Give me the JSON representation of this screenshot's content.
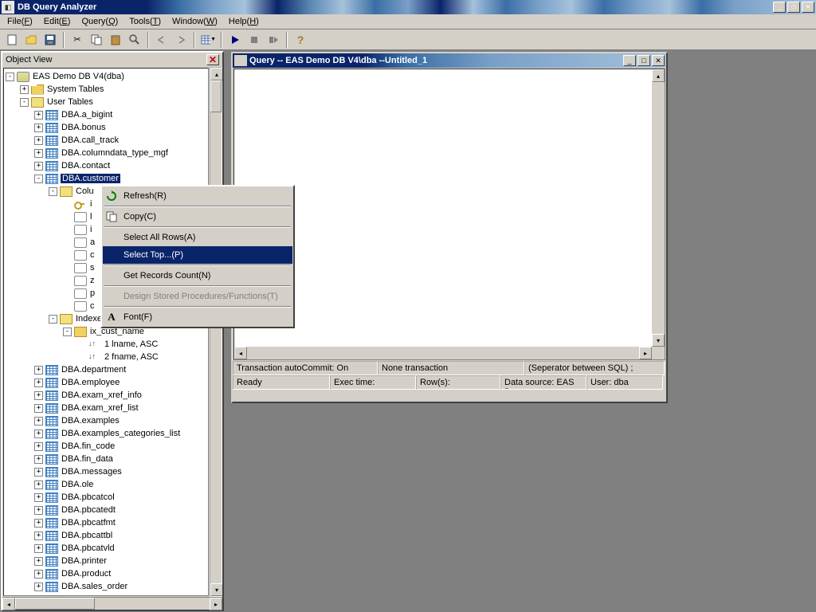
{
  "titlebar": {
    "title": "DB Query Analyzer"
  },
  "menubar": {
    "file": "File(F)",
    "edit": "Edit(E)",
    "query": "Query(Q)",
    "tools": "Tools(T)",
    "window": "Window(W)",
    "help": "Help(H)"
  },
  "objectview": {
    "title": "Object View",
    "root": "EAS Demo DB V4(dba)",
    "system_tables": "System Tables",
    "user_tables": "User Tables",
    "tables": [
      "DBA.a_bigint",
      "DBA.bonus",
      "DBA.call_track",
      "DBA.columndata_type_mgf",
      "DBA.contact"
    ],
    "selected_table": "DBA.customer",
    "columns_label": "Columns",
    "indexes_label": "Indexes",
    "index_name": "ix_cust_name",
    "index_cols": [
      "1  lname, ASC",
      "2  fname, ASC"
    ],
    "col_placeholders": [
      "i",
      "l",
      "i",
      "a",
      "c",
      "s",
      "z",
      "p",
      "c"
    ],
    "tables_after": [
      "DBA.department",
      "DBA.employee",
      "DBA.exam_xref_info",
      "DBA.exam_xref_list",
      "DBA.examples",
      "DBA.examples_categories_list",
      "DBA.fin_code",
      "DBA.fin_data",
      "DBA.messages",
      "DBA.ole",
      "DBA.pbcatcol",
      "DBA.pbcatedt",
      "DBA.pbcatfmt",
      "DBA.pbcattbl",
      "DBA.pbcatvld",
      "DBA.printer",
      "DBA.product",
      "DBA.sales_order"
    ]
  },
  "contextmenu": {
    "refresh": "Refresh(R)",
    "copy": "Copy(C)",
    "select_all": "Select All Rows(A)",
    "select_top": "Select Top...(P)",
    "get_count": "Get Records Count(N)",
    "design_sp": "Design Stored Procedures/Functions(T)",
    "font": "Font(F)"
  },
  "querywin": {
    "title": "Query -- EAS Demo DB V4\\dba  --Untitled_1",
    "status1": {
      "autocommit": "Transaction autoCommit: On",
      "transaction": "None transaction",
      "separator": "(Seperator between SQL)   ;"
    },
    "status2": {
      "ready": "Ready",
      "exectime": "Exec time:",
      "rows": "Row(s):",
      "datasource": "Data source: EAS Demo",
      "user": "User: dba"
    }
  }
}
